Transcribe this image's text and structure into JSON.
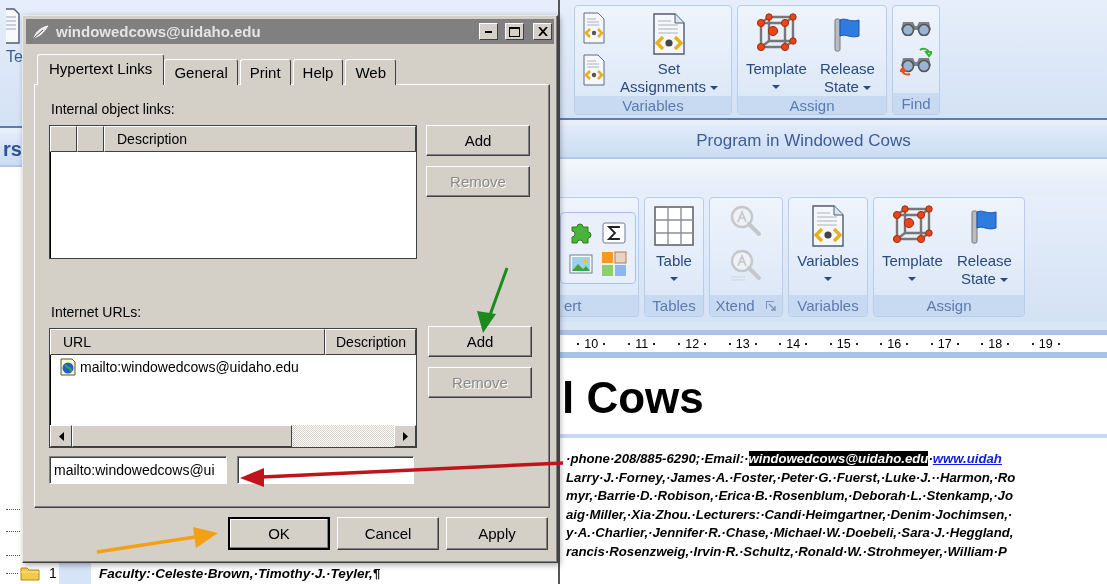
{
  "left_pane": {
    "ribbon_fragment": "Te",
    "title_fragment": "rs",
    "tree_number": "1"
  },
  "top_ribbon": {
    "groups": [
      {
        "kind": "variables_small",
        "label": "Variables",
        "buttons": [
          {
            "label": "Set Assignments",
            "kind": "menu_inline",
            "dropdown": true
          }
        ]
      },
      {
        "kind": "assign",
        "label": "Assign",
        "buttons": [
          {
            "label": "Template",
            "kind": "menu_below",
            "dropdown": true
          },
          {
            "label": "Release State",
            "kind": "menu_inline",
            "dropdown": true
          }
        ]
      },
      {
        "kind": "find",
        "label": "Find"
      }
    ]
  },
  "title_band": {
    "title": "Program in Windowed Cows"
  },
  "second_ribbon": {
    "groups": [
      {
        "kind": "insert",
        "label": "ert"
      },
      {
        "kind": "tables",
        "label": "Tables",
        "buttons": [
          {
            "label": "Table",
            "kind": "menu_below",
            "dropdown": true
          }
        ]
      },
      {
        "kind": "xtend",
        "label": "Xtend"
      },
      {
        "kind": "variables_large",
        "label": "Variables",
        "buttons": [
          {
            "label": "Variables",
            "kind": "menu_below",
            "dropdown": true
          }
        ]
      },
      {
        "kind": "assign",
        "label": "Assign",
        "buttons": [
          {
            "label": "Template",
            "kind": "menu_below",
            "dropdown": true
          },
          {
            "label": "Release State",
            "kind": "menu_inline",
            "dropdown": true
          }
        ]
      }
    ]
  },
  "ruler": {
    "numbers": [
      "10",
      "11",
      "12",
      "13",
      "14",
      "15",
      "16",
      "17",
      "18",
      "19"
    ]
  },
  "document": {
    "heading": "l Cows",
    "lines": [
      {
        "segments": [
          {
            "kind": "plain",
            "text": "·phone·208/885-6290;·Email:·"
          },
          {
            "kind": "highlight",
            "text": "windowedcows@uidaho.edu"
          },
          {
            "kind": "plain",
            "text": "·"
          },
          {
            "kind": "link",
            "text": "www.uidah"
          }
        ]
      },
      {
        "segments": [
          {
            "kind": "plain",
            "text": "Larry·J.·Forney,·James·A.·Foster,·Peter·G.·Fuerst,·Luke·J.··Harmon,·Ro"
          }
        ]
      },
      {
        "segments": [
          {
            "kind": "plain",
            "text": "myr,·Barrie·D.·Robison,·Erica·B.·Rosenblum,·Deborah·L.·Stenkamp,·Jo"
          }
        ]
      },
      {
        "segments": [
          {
            "kind": "plain",
            "text": "aig·Miller,·Xia·Zhou.·Lecturers:·Candi·Heimgartner,·Denim·Jochimsen,·"
          }
        ]
      },
      {
        "segments": [
          {
            "kind": "plain",
            "text": "y·A.·Charlier,·Jennifer·R.·Chase,·Michael·W.·Doebeli,·Sara·J.·Heggland,"
          }
        ]
      },
      {
        "segments": [
          {
            "kind": "plain",
            "text": "rancis·Rosenzweig,·Irvin·R.·Schultz,·Ronald·W.·Strohmeyer,·William·P"
          }
        ]
      }
    ],
    "bottom_line": "Faculty:·Celeste·Brown,·Timothy·J.·Teyler,¶"
  },
  "dialog": {
    "title": "windowedcows@uidaho.edu",
    "tabs": [
      {
        "label": "Hypertext Links",
        "selected": true
      },
      {
        "label": "General",
        "selected": false
      },
      {
        "label": "Print",
        "selected": false
      },
      {
        "label": "Help",
        "selected": false
      },
      {
        "label": "Web",
        "selected": false
      }
    ],
    "internal_links": {
      "label": "Internal object links:",
      "columns": [
        "Description"
      ],
      "buttons": [
        {
          "label": "Add",
          "disabled": false
        },
        {
          "label": "Remove",
          "disabled": true
        }
      ]
    },
    "internet_urls": {
      "label": "Internet URLs:",
      "columns": [
        "URL",
        "Description"
      ],
      "rows": [
        {
          "url": "mailto:windowedcows@uidaho.edu"
        }
      ],
      "buttons": [
        {
          "label": "Add",
          "disabled": false
        },
        {
          "label": "Remove",
          "disabled": true
        }
      ]
    },
    "url_field": {
      "value": "mailto:windowedcows@ui"
    },
    "footer_buttons": [
      {
        "label": "OK",
        "default": true
      },
      {
        "label": "Cancel",
        "default": false
      },
      {
        "label": "Apply",
        "default": false
      }
    ]
  }
}
